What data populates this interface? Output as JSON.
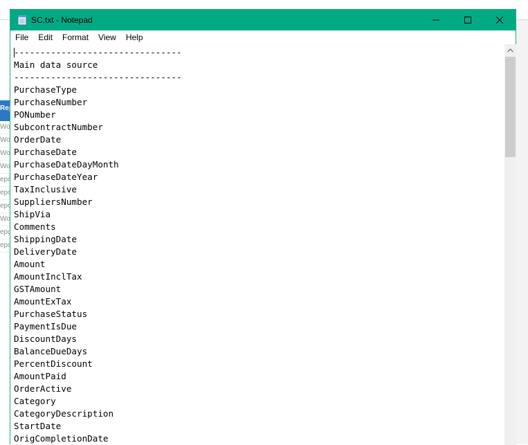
{
  "window": {
    "title": "SC.txt - Notepad",
    "icon": "notepad-icon",
    "controls": {
      "minimize": "—",
      "maximize": "☐",
      "close": "✕"
    },
    "accent_color": "#00ab84"
  },
  "menu": [
    "File",
    "Edit",
    "Format",
    "View",
    "Help"
  ],
  "document": {
    "lines": [
      "--------------------------------",
      "Main data source",
      "--------------------------------",
      "PurchaseType",
      "PurchaseNumber",
      "PONumber",
      "SubcontractNumber",
      "OrderDate",
      "PurchaseDate",
      "PurchaseDateDayMonth",
      "PurchaseDateYear",
      "TaxInclusive",
      "SuppliersNumber",
      "ShipVia",
      "Comments",
      "ShippingDate",
      "DeliveryDate",
      "Amount",
      "AmountInclTax",
      "GSTAmount",
      "AmountExTax",
      "PurchaseStatus",
      "PaymentIsDue",
      "DiscountDays",
      "BalanceDueDays",
      "PercentDiscount",
      "AmountPaid",
      "OrderActive",
      "Category",
      "CategoryDescription",
      "StartDate",
      "OrigCompletionDate"
    ]
  },
  "background": {
    "band_label": "Rep",
    "list_rows": [
      "Wor",
      "Wor",
      "Wor",
      "Wor",
      "epo",
      "epo",
      "epo",
      "Wor",
      "epo",
      "epo"
    ]
  }
}
